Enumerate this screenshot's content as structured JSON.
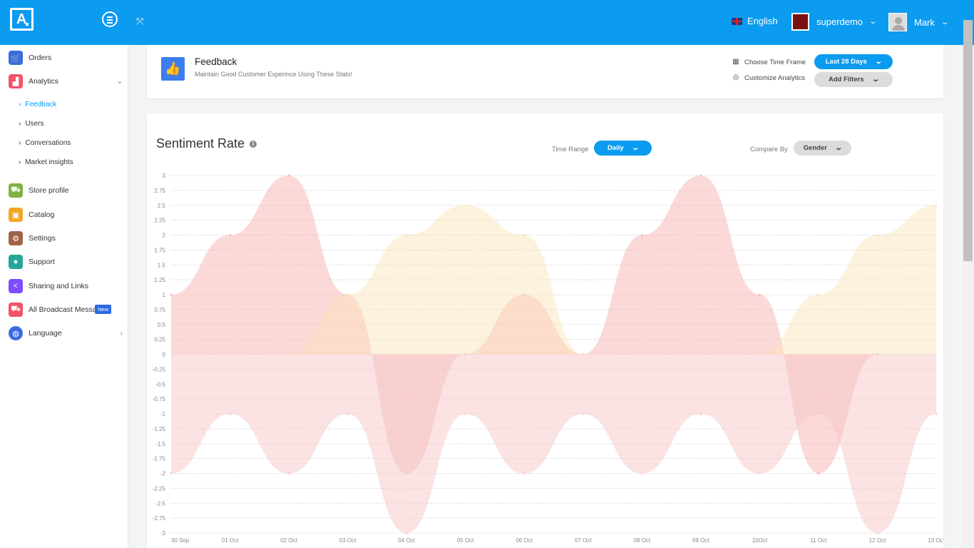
{
  "topbar": {
    "logo_text": "A",
    "language": "English",
    "store_name": "superdemo",
    "user_name": "Mark"
  },
  "sidebar": {
    "items": [
      {
        "label": "Orders",
        "icon": "cart-icon",
        "color": "#3d6be0"
      },
      {
        "label": "Analytics",
        "icon": "chart-icon",
        "color": "#ef5468"
      },
      {
        "label": "Store profile",
        "icon": "store-icon",
        "color": "#7cb342"
      },
      {
        "label": "Catalog",
        "icon": "catalog-icon",
        "color": "#f5a623"
      },
      {
        "label": "Settings",
        "icon": "gear-icon",
        "color": "#a0634a"
      },
      {
        "label": "Support",
        "icon": "chat-icon",
        "color": "#26a69a"
      },
      {
        "label": "Sharing and Links",
        "icon": "share-icon",
        "color": "#7c4dff"
      },
      {
        "label": "All Broadcast Message",
        "icon": "broadcast-icon",
        "color": "#ef5468"
      },
      {
        "label": "Language",
        "icon": "globe-icon",
        "color": "#3d6be0"
      }
    ],
    "analytics_sub": [
      "Feedback",
      "Users",
      "Conversations",
      "Market insights"
    ],
    "new_badge": "New"
  },
  "header": {
    "title": "Feedback",
    "subtitle": "Maintain Good Customer Experince Using These Stats!",
    "time_frame_label": "Choose Time Frame",
    "time_frame_value": "Last 28 Days",
    "customize_label": "Customize Analytics",
    "filters_label": "Add Filters"
  },
  "chart_panel": {
    "title": "Sentiment Rate",
    "time_range_label": "Time Range",
    "time_range_value": "Daily",
    "compare_label": "Compare By",
    "compare_value": "Gender"
  },
  "chart_data": {
    "type": "area",
    "x": [
      "30 Sep",
      "01 Oct",
      "02 Oct",
      "03 Oct",
      "04 Oct",
      "05 Oct",
      "06 Oct",
      "07 Oct",
      "08 Oct",
      "09 Oct",
      "10Oct",
      "11 Oct",
      "12 Oct",
      "13 Oct"
    ],
    "ylim": [
      -3,
      3
    ],
    "yticks": [
      "3",
      "2.75",
      "2.5",
      "2.25",
      "2",
      "1.75",
      "1.5",
      "1.25",
      "1",
      "0.75",
      "0.5",
      "0.25",
      "0",
      "-0.25",
      "-0.5",
      "-0.75",
      "-1",
      "-1.25",
      "-1.5",
      "-1.75",
      "-2",
      "-2.25",
      "-2.5",
      "-2.75",
      "-3"
    ],
    "grid": true,
    "series": [
      {
        "values": [
          1,
          2,
          3,
          1,
          -2,
          0,
          1,
          0,
          2,
          3,
          1,
          -2,
          0,
          null
        ],
        "color": "#f8b4b4"
      },
      {
        "values": [
          null,
          null,
          0,
          1,
          2,
          2.5,
          2,
          0,
          null,
          null,
          0,
          1,
          2,
          2.5
        ],
        "color": "#fbe3b5"
      },
      {
        "values": [
          -2,
          -1,
          -2,
          -1,
          -3,
          -1,
          -2,
          -1,
          -2,
          -1,
          -2,
          -1,
          -3,
          -1
        ],
        "color": "#f8c8c8"
      }
    ]
  }
}
